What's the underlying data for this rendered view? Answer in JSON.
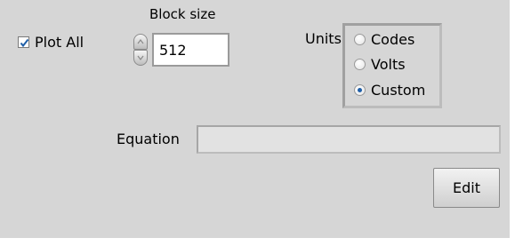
{
  "plot_all": {
    "label": "Plot All",
    "checked": true
  },
  "block_size": {
    "label": "Block size",
    "value": "512"
  },
  "units": {
    "label": "Units",
    "options": [
      {
        "label": "Codes",
        "selected": false
      },
      {
        "label": "Volts",
        "selected": false
      },
      {
        "label": "Custom",
        "selected": true
      }
    ]
  },
  "equation": {
    "label": "Equation",
    "value": ""
  },
  "edit_button": {
    "label": "Edit"
  },
  "colors": {
    "panel_background": "#d6d6d6",
    "check_mark": "#1f5fa8",
    "radio_selected_dot": "#1f5fa8"
  }
}
